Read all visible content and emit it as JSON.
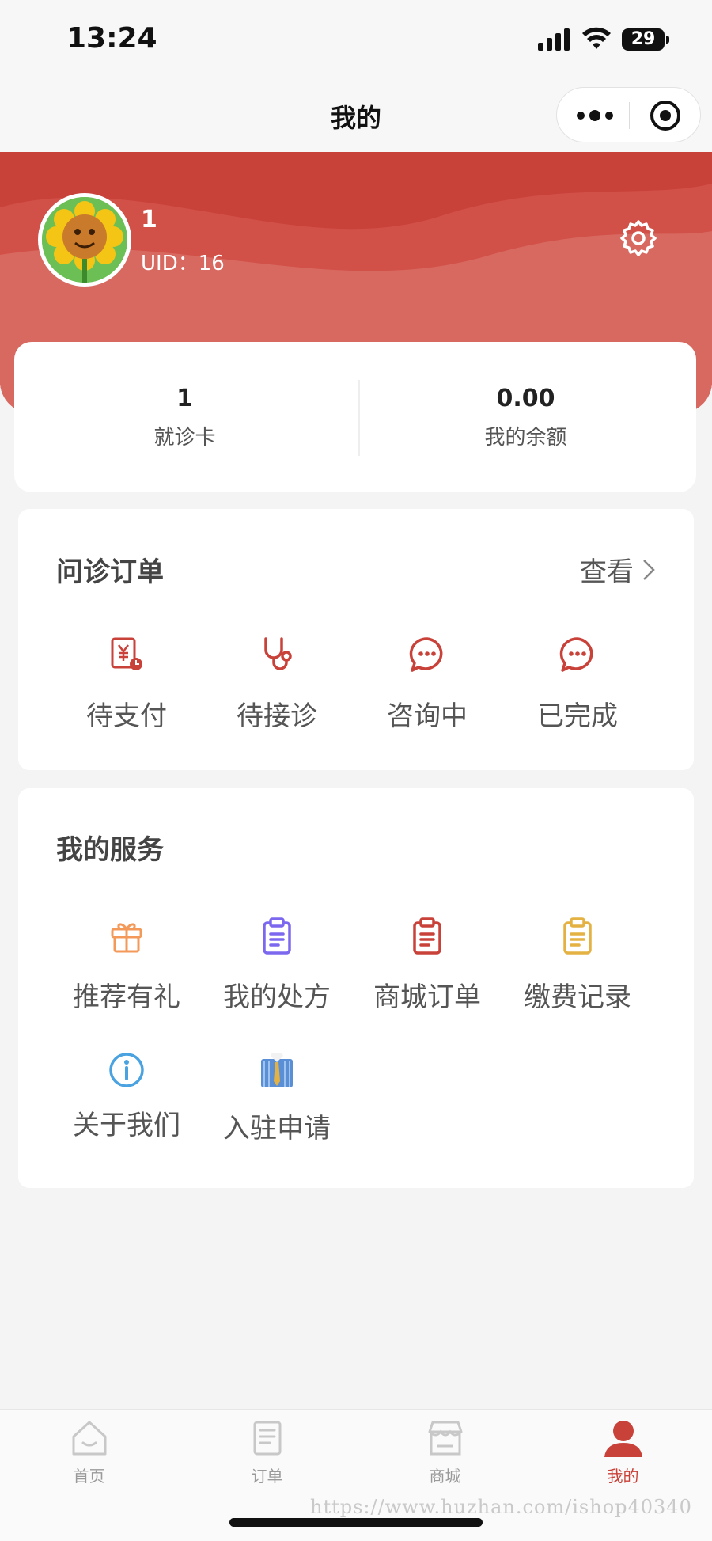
{
  "status_bar": {
    "time": "13:24",
    "battery": "29"
  },
  "nav": {
    "title": "我的"
  },
  "profile": {
    "name": "1",
    "uid": "UID：16"
  },
  "stats": [
    {
      "value": "1",
      "label": "就诊卡"
    },
    {
      "value": "0.00",
      "label": "我的余额"
    }
  ],
  "orders": {
    "title": "问诊订单",
    "view_label": "查看",
    "items": [
      {
        "label": "待支付",
        "icon": "payment-pending-icon"
      },
      {
        "label": "待接诊",
        "icon": "stethoscope-icon"
      },
      {
        "label": "咨询中",
        "icon": "chat-bubble-icon"
      },
      {
        "label": "已完成",
        "icon": "chat-bubble-icon"
      }
    ]
  },
  "services": {
    "title": "我的服务",
    "items": [
      {
        "label": "推荐有礼",
        "icon": "gift-icon"
      },
      {
        "label": "我的处方",
        "icon": "clipboard-icon"
      },
      {
        "label": "商城订单",
        "icon": "clipboard-icon"
      },
      {
        "label": "缴费记录",
        "icon": "clipboard-icon"
      },
      {
        "label": "关于我们",
        "icon": "info-icon"
      },
      {
        "label": "入驻申请",
        "icon": "suit-tie-icon"
      }
    ]
  },
  "tabs": [
    {
      "label": "首页",
      "icon": "home-icon"
    },
    {
      "label": "订单",
      "icon": "document-icon"
    },
    {
      "label": "商城",
      "icon": "store-icon"
    },
    {
      "label": "我的",
      "icon": "user-icon",
      "active": true
    }
  ],
  "watermark": "https://www.huzhan.com/ishop40340",
  "colors": {
    "primary": "#c9423a",
    "purple": "#7b68ee",
    "orange": "#f39a5b",
    "gold": "#e3b243",
    "blue": "#4aa3e0"
  }
}
